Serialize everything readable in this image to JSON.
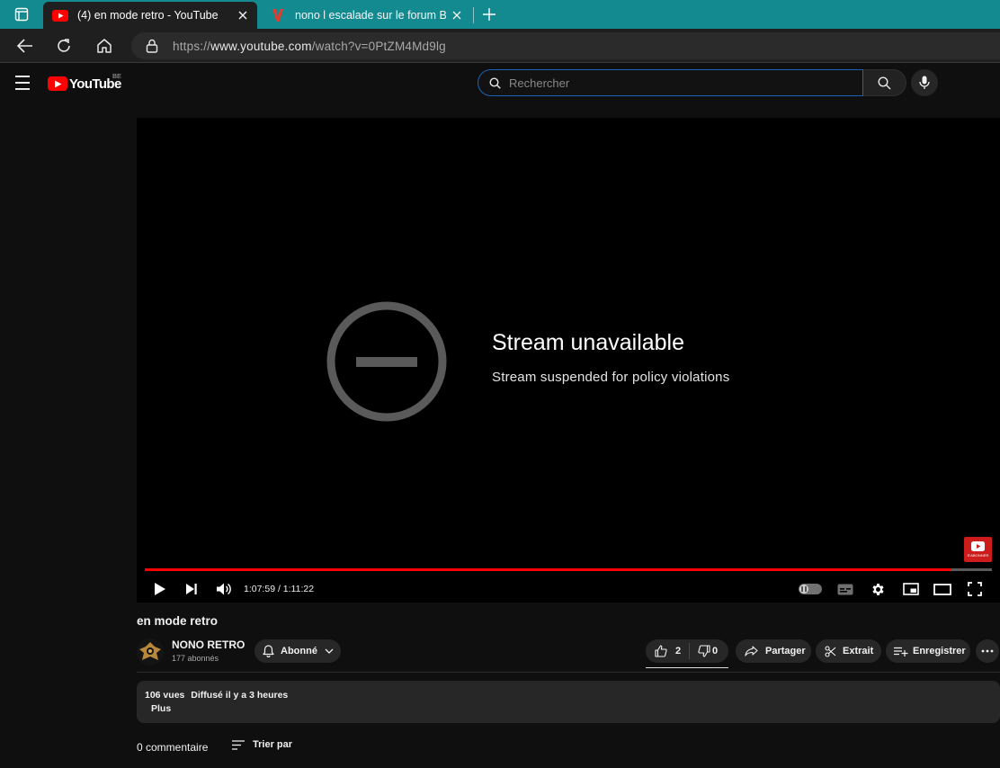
{
  "browser": {
    "tabs": [
      {
        "title": "(4) en mode retro - YouTube",
        "active": true
      },
      {
        "title": "nono l escalade sur le forum Blabla",
        "active": false
      }
    ],
    "url_prefix": "https://",
    "url_host": "www.youtube.com",
    "url_path": "/watch?v=0PtZM4Md9lg"
  },
  "youtube": {
    "logo_text": "YouTube",
    "region": "BE",
    "search_placeholder": "Rechercher"
  },
  "player": {
    "error_title": "Stream unavailable",
    "error_subtitle": "Stream suspended for policy violations",
    "watermark_text": "S'ABONNER",
    "time_display": "1:07:59 / 1:11:22",
    "progress_fraction": 0.9526
  },
  "video": {
    "title": "en mode retro",
    "channel_name": "NONO RETRO",
    "subscriber_count": "177 abonnés",
    "subscribed_label": "Abonné",
    "likes": "2",
    "dislikes": "0",
    "share_label": "Partager",
    "clip_label": "Extrait",
    "save_label": "Enregistrer",
    "views": "106 vues",
    "published": "Diffusé il y a 3 heures",
    "more_label": "Plus",
    "comment_count": "0 commentaire",
    "sort_label": "Trier par"
  },
  "colors": {
    "tabstrip": "#128a8f",
    "youtube_red": "#ff0000",
    "search_focus": "#1c62b9"
  }
}
